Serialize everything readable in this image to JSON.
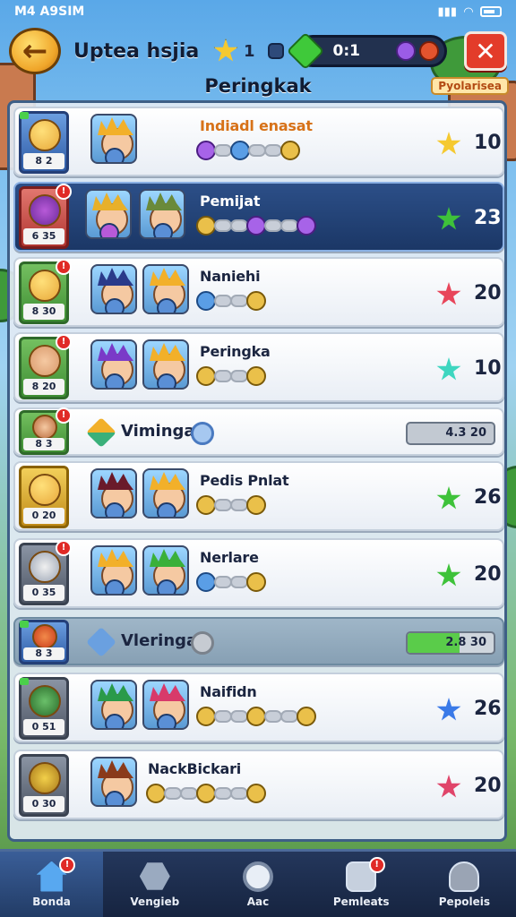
{
  "status": {
    "left_text": "M4 A9SIM",
    "right_text": ""
  },
  "header": {
    "title": "Uptea hsjia",
    "coins": "1",
    "gems": "0:1",
    "close_label": "✕",
    "back_label": "←"
  },
  "subheader": {
    "title": "Peringkak",
    "badge": "Pyolarisea"
  },
  "rows": [
    {
      "rank": "8 2",
      "name": "Indiadl enasat",
      "score": "10",
      "star_color": "#f5c930"
    },
    {
      "rank": "6 35",
      "name": "Pemijat",
      "score": "23",
      "star_color": "#3ec23a"
    },
    {
      "rank": "8 30",
      "name": "Naniehi",
      "score": "20",
      "star_color": "#e8455a"
    },
    {
      "rank": "8 20",
      "name": "Peringka",
      "score": "10",
      "star_color": "#3ed6c0"
    },
    {
      "rank": "8 3",
      "name": "Viminga",
      "progress": "4.3 20",
      "progress_fill": 0.0
    },
    {
      "rank": "0 20",
      "name": "Pedis Pnlat",
      "score": "26",
      "star_color": "#3ec23a"
    },
    {
      "rank": "0 35",
      "name": "Nerlare",
      "score": "20",
      "star_color": "#3ec23a"
    },
    {
      "rank": "8 3",
      "name": "Vleringa",
      "progress": "2.8 30",
      "progress_fill": 0.6
    },
    {
      "rank": "0 51",
      "name": "Naifidn",
      "score": "26",
      "star_color": "#3a7ae8"
    },
    {
      "rank": "0 30",
      "name": "NackBickari",
      "score": "20",
      "star_color": "#e0456a"
    }
  ],
  "nav": [
    {
      "label": "Bonda",
      "icon": "home-icon",
      "badge": "!"
    },
    {
      "label": "Vengieb",
      "icon": "hexagon-icon"
    },
    {
      "label": "Aac",
      "icon": "circle-icon"
    },
    {
      "label": "Pemleats",
      "icon": "mail-icon",
      "badge": "!"
    },
    {
      "label": "Pepoleis",
      "icon": "person-icon"
    }
  ],
  "notif_mark": "!"
}
